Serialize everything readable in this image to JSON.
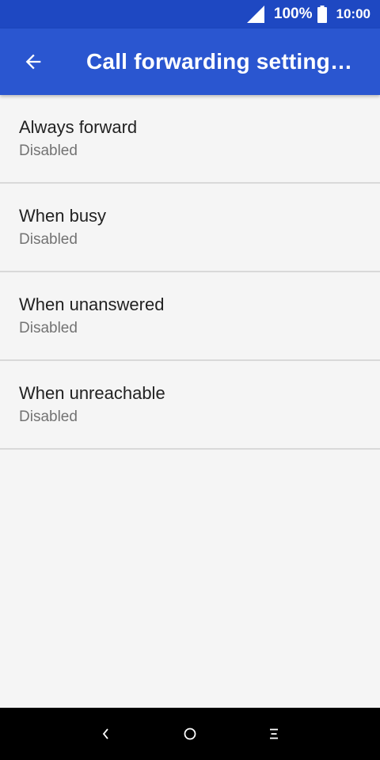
{
  "status_bar": {
    "battery_percent": "100%",
    "time": "10:00",
    "signal_icon": "signal-icon",
    "battery_icon": "battery-icon"
  },
  "app_bar": {
    "title": "Call forwarding setting…",
    "back_icon": "arrow-back-icon"
  },
  "list": {
    "items": [
      {
        "title": "Always forward",
        "summary": "Disabled"
      },
      {
        "title": "When busy",
        "summary": "Disabled"
      },
      {
        "title": "When unanswered",
        "summary": "Disabled"
      },
      {
        "title": "When unreachable",
        "summary": "Disabled"
      }
    ]
  },
  "nav_bar": {
    "back_icon": "nav-back-icon",
    "home_icon": "nav-home-icon",
    "menu_icon": "nav-menu-icon"
  },
  "colors": {
    "status_bar": "#1e48c2",
    "app_bar": "#2a56d0",
    "background": "#f5f5f5",
    "divider": "#d9d9d9"
  }
}
